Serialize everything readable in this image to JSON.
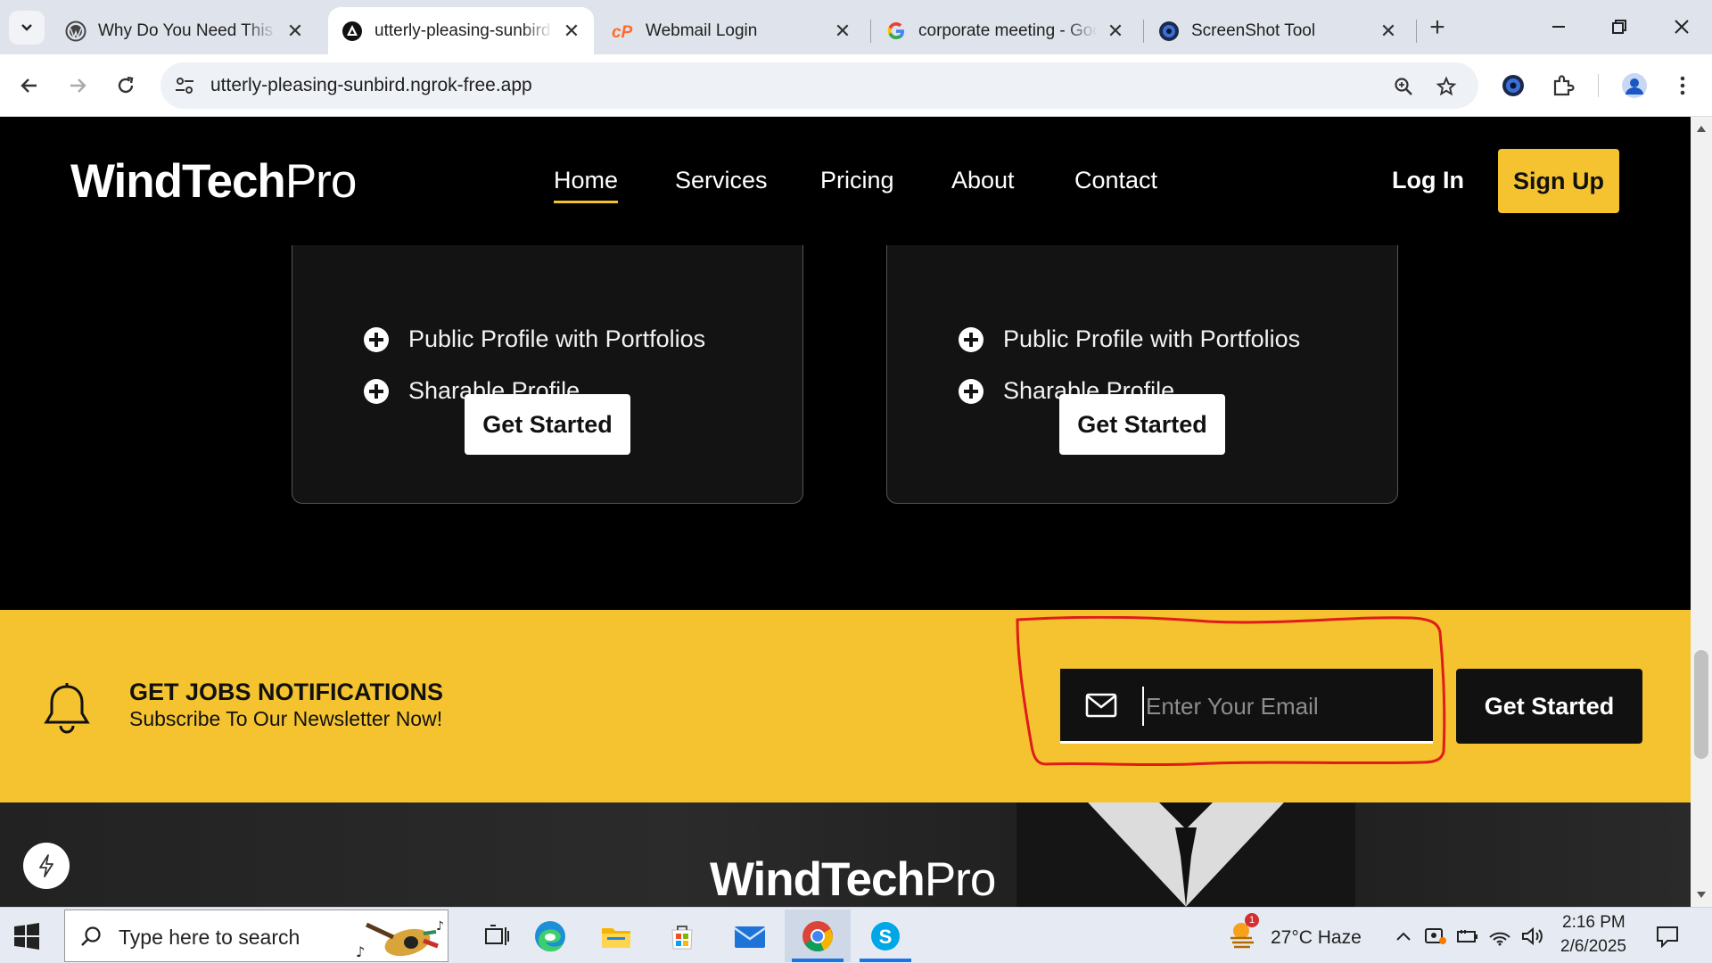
{
  "browser": {
    "tabs": [
      {
        "title": "Why Do You Need This Job",
        "active": false
      },
      {
        "title": "utterly-pleasing-sunbird.ngrok-free.app",
        "active": true
      },
      {
        "title": "Webmail Login",
        "active": false
      },
      {
        "title": "corporate meeting - Google Search",
        "active": false
      },
      {
        "title": "ScreenShot Tool",
        "active": false
      }
    ],
    "url": "utterly-pleasing-sunbird.ngrok-free.app"
  },
  "site": {
    "logo_bold": "WindTech",
    "logo_light": "Pro",
    "nav": [
      "Home",
      "Services",
      "Pricing",
      "About",
      "Contact"
    ],
    "active_nav": "Home",
    "login": "Log In",
    "signup": "Sign Up"
  },
  "plans": [
    {
      "features": [
        "Public Profile with Portfolios",
        "Sharable Profile"
      ],
      "button": "Get Started"
    },
    {
      "features": [
        "Public Profile with Portfolios",
        "Sharable Profile"
      ],
      "button": "Get Started"
    }
  ],
  "newsletter": {
    "title": "GET JOBS NOTIFICATIONS",
    "subtitle": "Subscribe To Our Newsletter Now!",
    "email_placeholder": "Enter Your Email",
    "email_value": "",
    "button": "Get Started",
    "accent_color": "#f4c32f",
    "annotation_color": "#e01b1b"
  },
  "footer": {
    "logo_bold": "WindTech",
    "logo_light": "Pro"
  },
  "taskbar": {
    "search_placeholder": "Type here to search",
    "weather": "27°C  Haze",
    "weather_badge": "1",
    "time": "2:16 PM",
    "date": "2/6/2025"
  }
}
